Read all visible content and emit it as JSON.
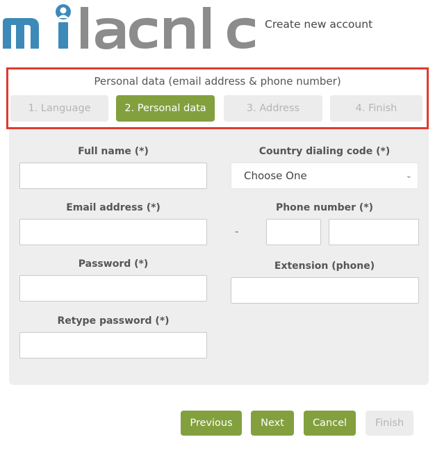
{
  "header": {
    "logo_text": "milacnic",
    "title": "Create new account"
  },
  "steps": {
    "heading": "Personal data (email address & phone number)",
    "items": [
      {
        "label": "1. Language",
        "active": false
      },
      {
        "label": "2. Personal data",
        "active": true
      },
      {
        "label": "3. Address",
        "active": false
      },
      {
        "label": "4. Finish",
        "active": false
      }
    ]
  },
  "form": {
    "full_name": {
      "label": "Full name (*)",
      "value": ""
    },
    "email": {
      "label": "Email address (*)",
      "value": ""
    },
    "password": {
      "label": "Password (*)",
      "value": ""
    },
    "retype_password": {
      "label": "Retype password (*)",
      "value": ""
    },
    "country_code": {
      "label": "Country dialing code (*)",
      "selected": "Choose One"
    },
    "phone": {
      "label": "Phone number (*)",
      "separator": "-",
      "area_value": "",
      "number_value": ""
    },
    "extension": {
      "label": "Extension (phone)",
      "value": ""
    }
  },
  "buttons": {
    "previous": "Previous",
    "next": "Next",
    "cancel": "Cancel",
    "finish": "Finish"
  },
  "colors": {
    "brand_blue": "#3d8ab8",
    "brand_gray": "#8c8c8c",
    "accent_green": "#82a03e",
    "highlight_red": "#e03a2f",
    "panel_gray": "#eeeeee"
  }
}
